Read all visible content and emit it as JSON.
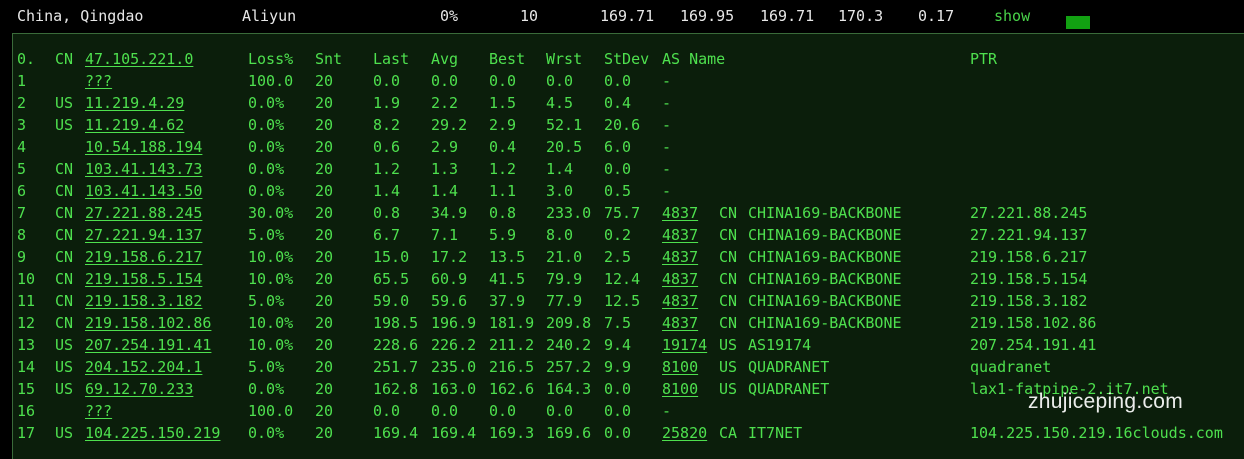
{
  "summary": {
    "location": "China, Qingdao",
    "provider": "Aliyun",
    "loss": "0%",
    "sent": "10",
    "last": "169.71",
    "avg": "169.95",
    "best": "169.71",
    "worst": "170.3",
    "stdev": "0.17",
    "show_label": "show",
    "indicator_color": "#12a112"
  },
  "header": {
    "hop": "0.",
    "cc": "CN",
    "ip": "47.105.221.0",
    "loss": "Loss%",
    "snt": "Snt",
    "last": "Last",
    "avg": "Avg",
    "best": "Best",
    "wrst": "Wrst",
    "stdev": "StDev",
    "asname": "AS Name",
    "ptr": "PTR"
  },
  "hops": [
    {
      "hop": "1",
      "cc": "",
      "ip": "???",
      "loss": "100.0",
      "snt": "20",
      "last": "0.0",
      "avg": "0.0",
      "best": "0.0",
      "wrst": "0.0",
      "stdev": "0.0",
      "asn": "-",
      "as_cc": "",
      "as_name": "",
      "ptr": ""
    },
    {
      "hop": "2",
      "cc": "US",
      "ip": "11.219.4.29",
      "loss": "0.0%",
      "snt": "20",
      "last": "1.9",
      "avg": "2.2",
      "best": "1.5",
      "wrst": "4.5",
      "stdev": "0.4",
      "asn": "-",
      "as_cc": "",
      "as_name": "",
      "ptr": ""
    },
    {
      "hop": "3",
      "cc": "US",
      "ip": "11.219.4.62",
      "loss": "0.0%",
      "snt": "20",
      "last": "8.2",
      "avg": "29.2",
      "best": "2.9",
      "wrst": "52.1",
      "stdev": "20.6",
      "asn": "-",
      "as_cc": "",
      "as_name": "",
      "ptr": ""
    },
    {
      "hop": "4",
      "cc": "",
      "ip": "10.54.188.194",
      "loss": "0.0%",
      "snt": "20",
      "last": "0.6",
      "avg": "2.9",
      "best": "0.4",
      "wrst": "20.5",
      "stdev": "6.0",
      "asn": "-",
      "as_cc": "",
      "as_name": "",
      "ptr": ""
    },
    {
      "hop": "5",
      "cc": "CN",
      "ip": "103.41.143.73",
      "loss": "0.0%",
      "snt": "20",
      "last": "1.2",
      "avg": "1.3",
      "best": "1.2",
      "wrst": "1.4",
      "stdev": "0.0",
      "asn": "-",
      "as_cc": "",
      "as_name": "",
      "ptr": ""
    },
    {
      "hop": "6",
      "cc": "CN",
      "ip": "103.41.143.50",
      "loss": "0.0%",
      "snt": "20",
      "last": "1.4",
      "avg": "1.4",
      "best": "1.1",
      "wrst": "3.0",
      "stdev": "0.5",
      "asn": "-",
      "as_cc": "",
      "as_name": "",
      "ptr": ""
    },
    {
      "hop": "7",
      "cc": "CN",
      "ip": "27.221.88.245",
      "loss": "30.0%",
      "snt": "20",
      "last": "0.8",
      "avg": "34.9",
      "best": "0.8",
      "wrst": "233.0",
      "stdev": "75.7",
      "asn": "4837",
      "as_cc": "CN",
      "as_name": "CHINA169-BACKBONE",
      "ptr": "27.221.88.245"
    },
    {
      "hop": "8",
      "cc": "CN",
      "ip": "27.221.94.137",
      "loss": "5.0%",
      "snt": "20",
      "last": "6.7",
      "avg": "7.1",
      "best": "5.9",
      "wrst": "8.0",
      "stdev": "0.2",
      "asn": "4837",
      "as_cc": "CN",
      "as_name": "CHINA169-BACKBONE",
      "ptr": "27.221.94.137"
    },
    {
      "hop": "9",
      "cc": "CN",
      "ip": "219.158.6.217",
      "loss": "10.0%",
      "snt": "20",
      "last": "15.0",
      "avg": "17.2",
      "best": "13.5",
      "wrst": "21.0",
      "stdev": "2.5",
      "asn": "4837",
      "as_cc": "CN",
      "as_name": "CHINA169-BACKBONE",
      "ptr": "219.158.6.217"
    },
    {
      "hop": "10",
      "cc": "CN",
      "ip": "219.158.5.154",
      "loss": "10.0%",
      "snt": "20",
      "last": "65.5",
      "avg": "60.9",
      "best": "41.5",
      "wrst": "79.9",
      "stdev": "12.4",
      "asn": "4837",
      "as_cc": "CN",
      "as_name": "CHINA169-BACKBONE",
      "ptr": "219.158.5.154"
    },
    {
      "hop": "11",
      "cc": "CN",
      "ip": "219.158.3.182",
      "loss": "5.0%",
      "snt": "20",
      "last": "59.0",
      "avg": "59.6",
      "best": "37.9",
      "wrst": "77.9",
      "stdev": "12.5",
      "asn": "4837",
      "as_cc": "CN",
      "as_name": "CHINA169-BACKBONE",
      "ptr": "219.158.3.182"
    },
    {
      "hop": "12",
      "cc": "CN",
      "ip": "219.158.102.86",
      "loss": "10.0%",
      "snt": "20",
      "last": "198.5",
      "avg": "196.9",
      "best": "181.9",
      "wrst": "209.8",
      "stdev": "7.5",
      "asn": "4837",
      "as_cc": "CN",
      "as_name": "CHINA169-BACKBONE",
      "ptr": "219.158.102.86"
    },
    {
      "hop": "13",
      "cc": "US",
      "ip": "207.254.191.41",
      "loss": "10.0%",
      "snt": "20",
      "last": "228.6",
      "avg": "226.2",
      "best": "211.2",
      "wrst": "240.2",
      "stdev": "9.4",
      "asn": "19174",
      "as_cc": "US",
      "as_name": "AS19174",
      "ptr": "207.254.191.41"
    },
    {
      "hop": "14",
      "cc": "US",
      "ip": "204.152.204.1",
      "loss": "5.0%",
      "snt": "20",
      "last": "251.7",
      "avg": "235.0",
      "best": "216.5",
      "wrst": "257.2",
      "stdev": "9.9",
      "asn": "8100",
      "as_cc": "US",
      "as_name": "QUADRANET",
      "ptr": "quadranet"
    },
    {
      "hop": "15",
      "cc": "US",
      "ip": "69.12.70.233",
      "loss": "0.0%",
      "snt": "20",
      "last": "162.8",
      "avg": "163.0",
      "best": "162.6",
      "wrst": "164.3",
      "stdev": "0.0",
      "asn": "8100",
      "as_cc": "US",
      "as_name": "QUADRANET",
      "ptr": "lax1-fatpipe-2.it7.net"
    },
    {
      "hop": "16",
      "cc": "",
      "ip": "???",
      "loss": "100.0",
      "snt": "20",
      "last": "0.0",
      "avg": "0.0",
      "best": "0.0",
      "wrst": "0.0",
      "stdev": "0.0",
      "asn": "-",
      "as_cc": "",
      "as_name": "",
      "ptr": ""
    },
    {
      "hop": "17",
      "cc": "US",
      "ip": "104.225.150.219",
      "loss": "0.0%",
      "snt": "20",
      "last": "169.4",
      "avg": "169.4",
      "best": "169.3",
      "wrst": "169.6",
      "stdev": "0.0",
      "asn": "25820",
      "as_cc": "CA",
      "as_name": "IT7NET",
      "ptr": "104.225.150.219.16clouds.com"
    }
  ],
  "watermark": "zhujiceping.com"
}
